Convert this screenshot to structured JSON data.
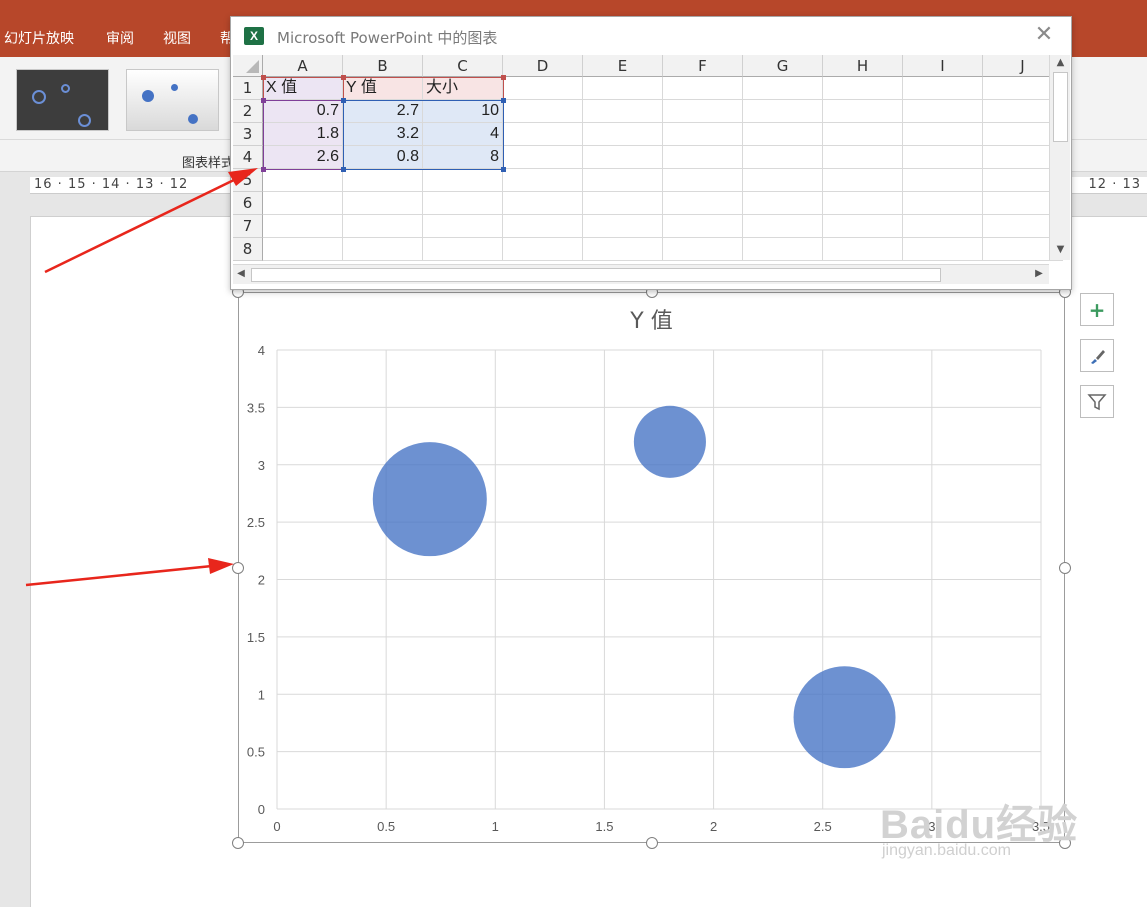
{
  "ribbon": {
    "tabs": [
      "幻灯片放映",
      "审阅",
      "视图",
      "帮"
    ],
    "group_label": "图表样式"
  },
  "ruler": {
    "left_marks": "16 · 15 · 14 · 13 · 12",
    "right_marks": "12 · 13"
  },
  "sheet": {
    "title": "Microsoft PowerPoint 中的图表",
    "close_glyph": "✕",
    "icon_letter": "X",
    "columns": [
      "A",
      "B",
      "C",
      "D",
      "E",
      "F",
      "G",
      "H",
      "I",
      "J"
    ],
    "rows": [
      "1",
      "2",
      "3",
      "4",
      "5",
      "6",
      "7",
      "8"
    ],
    "cells": {
      "A1": "X 值",
      "B1": "Y 值",
      "C1": "大小",
      "A2": "0.7",
      "B2": "2.7",
      "C2": "10",
      "A3": "1.8",
      "B3": "3.2",
      "C3": "4",
      "A4": "2.6",
      "B4": "0.8",
      "C4": "8"
    }
  },
  "side_buttons": {
    "add": "+",
    "style": "brush-icon",
    "filter": "filter-icon"
  },
  "chart_data": {
    "type": "bubble",
    "title": "Y 值",
    "xlim": [
      0,
      3.5
    ],
    "ylim": [
      0,
      4
    ],
    "x_ticks": [
      "0",
      "0.5",
      "1",
      "1.5",
      "2",
      "2.5",
      "3",
      "3.5"
    ],
    "y_ticks": [
      "0",
      "0.5",
      "1",
      "1.5",
      "2",
      "2.5",
      "3",
      "3.5",
      "4"
    ],
    "grid": true,
    "series": [
      {
        "color": "#4472c4",
        "points": [
          {
            "x": 0.7,
            "y": 2.7,
            "size": 10
          },
          {
            "x": 1.8,
            "y": 3.2,
            "size": 4
          },
          {
            "x": 2.6,
            "y": 0.8,
            "size": 8
          }
        ]
      }
    ]
  },
  "watermark": {
    "logo": "Baidu经验",
    "url": "jingyan.baidu.com"
  }
}
